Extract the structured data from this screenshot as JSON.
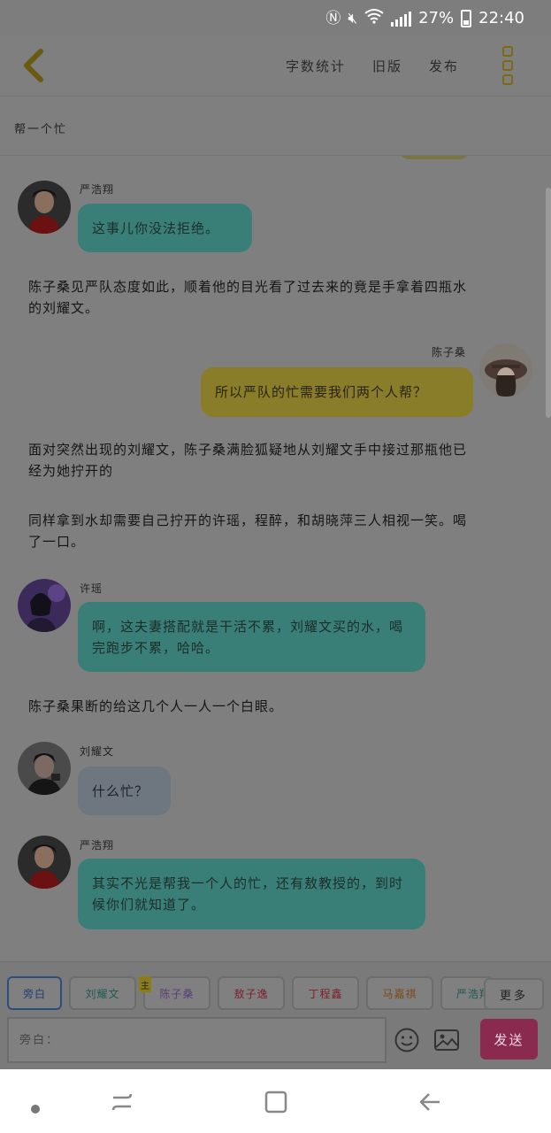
{
  "status_bar": {
    "battery": "27%",
    "time": "22:40"
  },
  "header": {
    "actions": [
      "字数统计",
      "旧版",
      "发布"
    ]
  },
  "chapter_title": "帮一个忙",
  "messages": [
    {
      "speaker": "严浩翔",
      "text": "这事儿你没法拒绝。"
    },
    {
      "narration": "陈子桑见严队态度如此，顺着他的目光看了过去来的竟是手拿着四瓶水的刘耀文。"
    },
    {
      "speaker": "陈子桑",
      "text": "所以严队的忙需要我们两个人帮？"
    },
    {
      "narration": "面对突然出现的刘耀文，陈子桑满脸狐疑地从刘耀文手中接过那瓶他已经为她拧开的"
    },
    {
      "narration": "同样拿到水却需要自己拧开的许瑶，程醉，和胡晓萍三人相视一笑。喝了一口。"
    },
    {
      "speaker": "许瑶",
      "text": "啊，这夫妻搭配就是干活不累，刘耀文买的水，喝完跑步不累，哈哈。"
    },
    {
      "narration": "陈子桑果断的给这几个人一人一个白眼。"
    },
    {
      "speaker": "刘耀文",
      "text": "什么忙？"
    },
    {
      "speaker": "严浩翔",
      "text": "其实不光是帮我一个人的忙，还有敖教授的，到时候你们就知道了。"
    }
  ],
  "characters": [
    "旁白",
    "刘耀文",
    "陈子桑",
    "敖子逸",
    "丁程鑫",
    "马嘉祺",
    "严浩翔"
  ],
  "main_badge": "主",
  "more_label": "更多",
  "input": {
    "placeholder": "旁白："
  },
  "send_label": "发送",
  "colors": {
    "teal": "#3a7f77",
    "yellow": "#8a7d2a",
    "grey": "#6e7680",
    "send": "#8a2a4e",
    "accent": "#7a6a12"
  },
  "icons": [
    "back-arrow-icon",
    "more-icon",
    "emoji-icon",
    "image-icon",
    "recent-apps-icon",
    "home-icon",
    "back-icon"
  ]
}
